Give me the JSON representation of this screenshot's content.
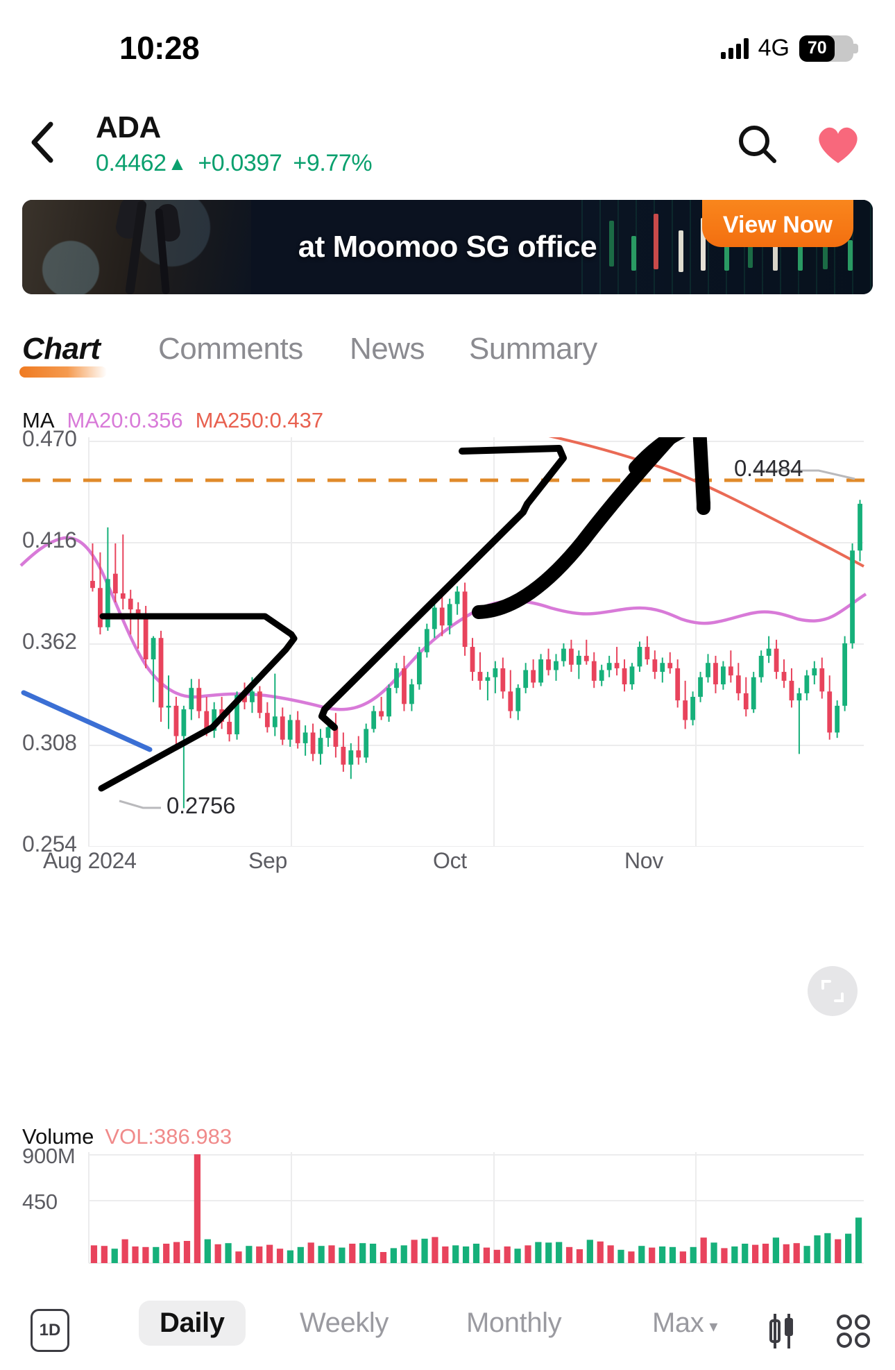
{
  "status_bar": {
    "time": "10:28",
    "network": "4G",
    "battery_percent": "70",
    "signal_icon": "signal-bars-icon",
    "battery_icon": "battery-icon"
  },
  "header": {
    "back_icon": "chevron-left-icon",
    "symbol": "ADA",
    "price": "0.4462",
    "arrow": "▲",
    "change": "+0.0397",
    "change_percent": "+9.77%",
    "search_icon": "search-icon",
    "favorite_icon": "heart-icon"
  },
  "banner": {
    "text": "at Moomoo SG office",
    "cta_label": "View Now"
  },
  "tabs": [
    {
      "label": "Chart",
      "active": true
    },
    {
      "label": "Comments",
      "active": false
    },
    {
      "label": "News",
      "active": false
    },
    {
      "label": "Summary",
      "active": false
    }
  ],
  "ma_legend": {
    "label": "MA",
    "ma20": "MA20:0.356",
    "ma250": "MA250:0.437",
    "ma20_color": "#d87ad8",
    "ma250_color": "#e8604f"
  },
  "volume_legend": {
    "label": "Volume",
    "value": "VOL:386.983",
    "value_color": "#f08a8a"
  },
  "chart_markers": {
    "high_label": "0.4484",
    "low_label": "0.2756"
  },
  "fullscreen_icon": "expand-icon",
  "bottom_bar": {
    "period_icon_label": "1D",
    "items": [
      {
        "label": "Daily",
        "active": true
      },
      {
        "label": "Weekly",
        "active": false
      },
      {
        "label": "Monthly",
        "active": false
      },
      {
        "label": "Max",
        "active": false,
        "has_caret": true
      }
    ],
    "candle_icon": "candlestick-icon",
    "grid_icon": "grid-indicators-icon"
  },
  "chart_data": {
    "type": "candlestick",
    "title": "ADA Daily",
    "xlabel": "",
    "ylabel": "",
    "grid": true,
    "legend_position": "top-left",
    "ylim": [
      0.254,
      0.4835
    ],
    "y_ticks": [
      "0.470",
      "0.416",
      "0.362",
      "0.308",
      "0.254"
    ],
    "y_tick_values": [
      0.47,
      0.416,
      0.362,
      0.308,
      0.254
    ],
    "x_ticks": [
      "Aug 2024",
      "Sep",
      "Oct",
      "Nov"
    ],
    "reference_line": {
      "value": 0.4484,
      "color": "#e08a2a",
      "style": "dashed"
    },
    "annotations": [
      {
        "text": "0.4484",
        "type": "period-high",
        "value": 0.4484
      },
      {
        "text": "0.2756",
        "type": "period-low",
        "value": 0.2756
      }
    ],
    "series": [
      {
        "name": "MA20",
        "color": "#d87ad8",
        "last_value": 0.356
      },
      {
        "name": "MA250",
        "color": "#e8604f",
        "last_value": 0.437
      }
    ],
    "candles": [
      {
        "o": 0.403,
        "h": 0.424,
        "l": 0.397,
        "c": 0.399
      },
      {
        "o": 0.399,
        "h": 0.419,
        "l": 0.373,
        "c": 0.377
      },
      {
        "o": 0.377,
        "h": 0.433,
        "l": 0.375,
        "c": 0.404
      },
      {
        "o": 0.407,
        "h": 0.424,
        "l": 0.391,
        "c": 0.396
      },
      {
        "o": 0.396,
        "h": 0.429,
        "l": 0.387,
        "c": 0.393
      },
      {
        "o": 0.393,
        "h": 0.398,
        "l": 0.373,
        "c": 0.387
      },
      {
        "o": 0.387,
        "h": 0.391,
        "l": 0.365,
        "c": 0.383
      },
      {
        "o": 0.383,
        "h": 0.389,
        "l": 0.354,
        "c": 0.359
      },
      {
        "o": 0.359,
        "h": 0.372,
        "l": 0.335,
        "c": 0.371
      },
      {
        "o": 0.371,
        "h": 0.375,
        "l": 0.324,
        "c": 0.332
      },
      {
        "o": 0.332,
        "h": 0.35,
        "l": 0.32,
        "c": 0.333
      },
      {
        "o": 0.333,
        "h": 0.338,
        "l": 0.311,
        "c": 0.316
      },
      {
        "o": 0.316,
        "h": 0.333,
        "l": 0.2756,
        "c": 0.331
      },
      {
        "o": 0.331,
        "h": 0.348,
        "l": 0.325,
        "c": 0.343
      },
      {
        "o": 0.343,
        "h": 0.348,
        "l": 0.326,
        "c": 0.33
      },
      {
        "o": 0.33,
        "h": 0.338,
        "l": 0.316,
        "c": 0.319
      },
      {
        "o": 0.319,
        "h": 0.335,
        "l": 0.315,
        "c": 0.331
      },
      {
        "o": 0.331,
        "h": 0.338,
        "l": 0.32,
        "c": 0.324
      },
      {
        "o": 0.324,
        "h": 0.33,
        "l": 0.313,
        "c": 0.317
      },
      {
        "o": 0.317,
        "h": 0.341,
        "l": 0.314,
        "c": 0.339
      },
      {
        "o": 0.339,
        "h": 0.346,
        "l": 0.331,
        "c": 0.335
      },
      {
        "o": 0.335,
        "h": 0.349,
        "l": 0.329,
        "c": 0.341
      },
      {
        "o": 0.341,
        "h": 0.344,
        "l": 0.326,
        "c": 0.329
      },
      {
        "o": 0.329,
        "h": 0.335,
        "l": 0.318,
        "c": 0.321
      },
      {
        "o": 0.321,
        "h": 0.351,
        "l": 0.316,
        "c": 0.327
      },
      {
        "o": 0.327,
        "h": 0.332,
        "l": 0.311,
        "c": 0.314
      },
      {
        "o": 0.314,
        "h": 0.328,
        "l": 0.31,
        "c": 0.325
      },
      {
        "o": 0.325,
        "h": 0.33,
        "l": 0.309,
        "c": 0.312
      },
      {
        "o": 0.312,
        "h": 0.322,
        "l": 0.305,
        "c": 0.318
      },
      {
        "o": 0.318,
        "h": 0.323,
        "l": 0.302,
        "c": 0.306
      },
      {
        "o": 0.306,
        "h": 0.32,
        "l": 0.3,
        "c": 0.315
      },
      {
        "o": 0.315,
        "h": 0.326,
        "l": 0.31,
        "c": 0.321
      },
      {
        "o": 0.321,
        "h": 0.329,
        "l": 0.304,
        "c": 0.31
      },
      {
        "o": 0.31,
        "h": 0.318,
        "l": 0.296,
        "c": 0.3
      },
      {
        "o": 0.3,
        "h": 0.312,
        "l": 0.292,
        "c": 0.308
      },
      {
        "o": 0.308,
        "h": 0.316,
        "l": 0.3,
        "c": 0.304
      },
      {
        "o": 0.304,
        "h": 0.323,
        "l": 0.301,
        "c": 0.32
      },
      {
        "o": 0.32,
        "h": 0.333,
        "l": 0.318,
        "c": 0.33
      },
      {
        "o": 0.33,
        "h": 0.338,
        "l": 0.325,
        "c": 0.327
      },
      {
        "o": 0.327,
        "h": 0.345,
        "l": 0.324,
        "c": 0.343
      },
      {
        "o": 0.343,
        "h": 0.357,
        "l": 0.34,
        "c": 0.354
      },
      {
        "o": 0.354,
        "h": 0.361,
        "l": 0.33,
        "c": 0.334
      },
      {
        "o": 0.334,
        "h": 0.348,
        "l": 0.33,
        "c": 0.345
      },
      {
        "o": 0.345,
        "h": 0.366,
        "l": 0.342,
        "c": 0.363
      },
      {
        "o": 0.363,
        "h": 0.379,
        "l": 0.36,
        "c": 0.376
      },
      {
        "o": 0.376,
        "h": 0.392,
        "l": 0.371,
        "c": 0.388
      },
      {
        "o": 0.388,
        "h": 0.395,
        "l": 0.372,
        "c": 0.378
      },
      {
        "o": 0.378,
        "h": 0.393,
        "l": 0.373,
        "c": 0.39
      },
      {
        "o": 0.39,
        "h": 0.4,
        "l": 0.384,
        "c": 0.397
      },
      {
        "o": 0.397,
        "h": 0.402,
        "l": 0.361,
        "c": 0.366
      },
      {
        "o": 0.366,
        "h": 0.371,
        "l": 0.347,
        "c": 0.352
      },
      {
        "o": 0.352,
        "h": 0.363,
        "l": 0.342,
        "c": 0.347
      },
      {
        "o": 0.347,
        "h": 0.352,
        "l": 0.336,
        "c": 0.349
      },
      {
        "o": 0.349,
        "h": 0.358,
        "l": 0.34,
        "c": 0.354
      },
      {
        "o": 0.354,
        "h": 0.36,
        "l": 0.337,
        "c": 0.341
      },
      {
        "o": 0.341,
        "h": 0.353,
        "l": 0.326,
        "c": 0.33
      },
      {
        "o": 0.33,
        "h": 0.345,
        "l": 0.325,
        "c": 0.343
      },
      {
        "o": 0.343,
        "h": 0.357,
        "l": 0.34,
        "c": 0.353
      },
      {
        "o": 0.353,
        "h": 0.359,
        "l": 0.343,
        "c": 0.346
      },
      {
        "o": 0.346,
        "h": 0.362,
        "l": 0.344,
        "c": 0.359
      },
      {
        "o": 0.359,
        "h": 0.365,
        "l": 0.35,
        "c": 0.353
      },
      {
        "o": 0.353,
        "h": 0.362,
        "l": 0.347,
        "c": 0.358
      },
      {
        "o": 0.358,
        "h": 0.368,
        "l": 0.355,
        "c": 0.365
      },
      {
        "o": 0.365,
        "h": 0.37,
        "l": 0.352,
        "c": 0.356
      },
      {
        "o": 0.356,
        "h": 0.364,
        "l": 0.348,
        "c": 0.361
      },
      {
        "o": 0.361,
        "h": 0.37,
        "l": 0.356,
        "c": 0.358
      },
      {
        "o": 0.358,
        "h": 0.363,
        "l": 0.343,
        "c": 0.347
      },
      {
        "o": 0.347,
        "h": 0.356,
        "l": 0.344,
        "c": 0.353
      },
      {
        "o": 0.353,
        "h": 0.361,
        "l": 0.349,
        "c": 0.357
      },
      {
        "o": 0.357,
        "h": 0.366,
        "l": 0.35,
        "c": 0.354
      },
      {
        "o": 0.354,
        "h": 0.359,
        "l": 0.341,
        "c": 0.345
      },
      {
        "o": 0.345,
        "h": 0.357,
        "l": 0.342,
        "c": 0.355
      },
      {
        "o": 0.355,
        "h": 0.369,
        "l": 0.352,
        "c": 0.366
      },
      {
        "o": 0.366,
        "h": 0.372,
        "l": 0.356,
        "c": 0.359
      },
      {
        "o": 0.359,
        "h": 0.364,
        "l": 0.348,
        "c": 0.352
      },
      {
        "o": 0.352,
        "h": 0.36,
        "l": 0.346,
        "c": 0.357
      },
      {
        "o": 0.357,
        "h": 0.363,
        "l": 0.351,
        "c": 0.354
      },
      {
        "o": 0.354,
        "h": 0.359,
        "l": 0.332,
        "c": 0.336
      },
      {
        "o": 0.336,
        "h": 0.347,
        "l": 0.32,
        "c": 0.325
      },
      {
        "o": 0.325,
        "h": 0.341,
        "l": 0.322,
        "c": 0.338
      },
      {
        "o": 0.338,
        "h": 0.352,
        "l": 0.335,
        "c": 0.349
      },
      {
        "o": 0.349,
        "h": 0.362,
        "l": 0.346,
        "c": 0.357
      },
      {
        "o": 0.357,
        "h": 0.361,
        "l": 0.34,
        "c": 0.345
      },
      {
        "o": 0.345,
        "h": 0.358,
        "l": 0.342,
        "c": 0.355
      },
      {
        "o": 0.355,
        "h": 0.364,
        "l": 0.346,
        "c": 0.35
      },
      {
        "o": 0.35,
        "h": 0.357,
        "l": 0.336,
        "c": 0.34
      },
      {
        "o": 0.34,
        "h": 0.349,
        "l": 0.327,
        "c": 0.331
      },
      {
        "o": 0.331,
        "h": 0.352,
        "l": 0.329,
        "c": 0.349
      },
      {
        "o": 0.349,
        "h": 0.364,
        "l": 0.346,
        "c": 0.361
      },
      {
        "o": 0.361,
        "h": 0.372,
        "l": 0.357,
        "c": 0.365
      },
      {
        "o": 0.365,
        "h": 0.37,
        "l": 0.348,
        "c": 0.352
      },
      {
        "o": 0.352,
        "h": 0.359,
        "l": 0.343,
        "c": 0.347
      },
      {
        "o": 0.347,
        "h": 0.354,
        "l": 0.332,
        "c": 0.336
      },
      {
        "o": 0.336,
        "h": 0.343,
        "l": 0.306,
        "c": 0.34
      },
      {
        "o": 0.34,
        "h": 0.353,
        "l": 0.336,
        "c": 0.35
      },
      {
        "o": 0.35,
        "h": 0.358,
        "l": 0.345,
        "c": 0.354
      },
      {
        "o": 0.354,
        "h": 0.36,
        "l": 0.337,
        "c": 0.341
      },
      {
        "o": 0.341,
        "h": 0.35,
        "l": 0.314,
        "c": 0.318
      },
      {
        "o": 0.318,
        "h": 0.336,
        "l": 0.315,
        "c": 0.333
      },
      {
        "o": 0.333,
        "h": 0.372,
        "l": 0.33,
        "c": 0.368
      },
      {
        "o": 0.368,
        "h": 0.424,
        "l": 0.365,
        "c": 0.42
      },
      {
        "o": 0.42,
        "h": 0.4484,
        "l": 0.414,
        "c": 0.4462
      }
    ],
    "volume": {
      "y_ticks": [
        "900M",
        "450"
      ],
      "y_tick_values": [
        900,
        450
      ],
      "values": [
        160,
        155,
        130,
        215,
        150,
        145,
        145,
        175,
        190,
        200,
        980,
        215,
        170,
        180,
        105,
        155,
        150,
        165,
        130,
        115,
        145,
        185,
        155,
        160,
        140,
        175,
        180,
        175,
        100,
        135,
        160,
        210,
        220,
        235,
        150,
        160,
        150,
        175,
        140,
        120,
        150,
        130,
        160,
        190,
        185,
        190,
        145,
        125,
        210,
        195,
        160,
        120,
        105,
        155,
        140,
        150,
        145,
        105,
        145,
        230,
        185,
        135,
        150,
        175,
        165,
        175,
        230,
        170,
        180,
        155,
        250,
        270,
        215,
        265,
        410
      ],
      "colors": [
        "red",
        "red",
        "green",
        "red",
        "red",
        "red",
        "green",
        "red",
        "red",
        "red",
        "red",
        "green",
        "red",
        "green",
        "red",
        "green",
        "red",
        "red",
        "red",
        "green",
        "green",
        "red",
        "green",
        "red",
        "green",
        "red",
        "green",
        "green",
        "red",
        "green",
        "green",
        "red",
        "green",
        "red",
        "red",
        "green",
        "green",
        "green",
        "red",
        "red",
        "red",
        "green",
        "red",
        "green",
        "green",
        "green",
        "red",
        "red",
        "green",
        "red",
        "red",
        "green",
        "red",
        "green",
        "red",
        "green",
        "green",
        "red",
        "green",
        "red",
        "green",
        "red",
        "green",
        "green",
        "red",
        "red",
        "green",
        "red",
        "red",
        "green",
        "green",
        "green",
        "red",
        "green",
        "green"
      ]
    },
    "drawings": [
      {
        "type": "line",
        "color": "#3b6fd4",
        "desc": "descending-trendline"
      },
      {
        "type": "polyline",
        "color": "#000000",
        "desc": "arrow-up-1"
      },
      {
        "type": "polyline",
        "color": "#000000",
        "desc": "arrow-up-2"
      },
      {
        "type": "polyline",
        "color": "#000000",
        "desc": "arrow-up-3-bold"
      }
    ]
  }
}
